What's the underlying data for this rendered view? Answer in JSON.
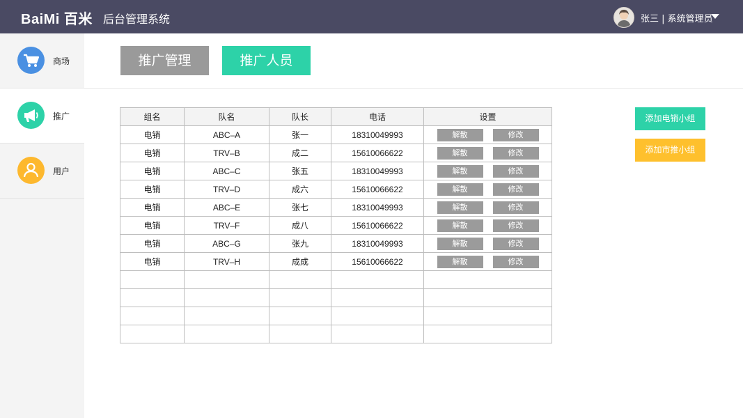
{
  "header": {
    "logo": "BaiMi 百米",
    "system_title": "后台管理系统",
    "user_label": "张三 | 系统管理员"
  },
  "sidebar": {
    "items": [
      {
        "label": "商场",
        "icon": "cart-icon",
        "color": "#4a90e2"
      },
      {
        "label": "推广",
        "icon": "megaphone-icon",
        "color": "#2dd2a8"
      },
      {
        "label": "用户",
        "icon": "user-icon",
        "color": "#fdb82e"
      }
    ],
    "active_index": 1
  },
  "tabs": [
    {
      "label": "推广管理"
    },
    {
      "label": "推广人员"
    }
  ],
  "table": {
    "columns": [
      "组名",
      "队名",
      "队长",
      "电话",
      "设置"
    ],
    "rows": [
      {
        "group": "电销",
        "team": "ABC–A",
        "leader": "张一",
        "phone": "18310049993"
      },
      {
        "group": "电销",
        "team": "TRV–B",
        "leader": "成二",
        "phone": "15610066622"
      },
      {
        "group": "电销",
        "team": "ABC–C",
        "leader": "张五",
        "phone": "18310049993"
      },
      {
        "group": "电销",
        "team": "TRV–D",
        "leader": "成六",
        "phone": "15610066622"
      },
      {
        "group": "电销",
        "team": "ABC–E",
        "leader": "张七",
        "phone": "18310049993"
      },
      {
        "group": "电销",
        "team": "TRV–F",
        "leader": "成八",
        "phone": "15610066622"
      },
      {
        "group": "电销",
        "team": "ABC–G",
        "leader": "张九",
        "phone": "18310049993"
      },
      {
        "group": "电销",
        "team": "TRV–H",
        "leader": "成成",
        "phone": "15610066622"
      }
    ],
    "row_actions": {
      "dissolve": "解散",
      "edit": "修改"
    }
  },
  "actions": {
    "add_phone_group": "添加电销小组",
    "add_market_group": "添加市推小组"
  },
  "colors": {
    "header_bg": "#4a4a63",
    "accent_green": "#2dd2a8",
    "accent_yellow": "#fec02d",
    "tab_gray": "#9a9a9a",
    "button_gray": "#9b9b9b"
  }
}
